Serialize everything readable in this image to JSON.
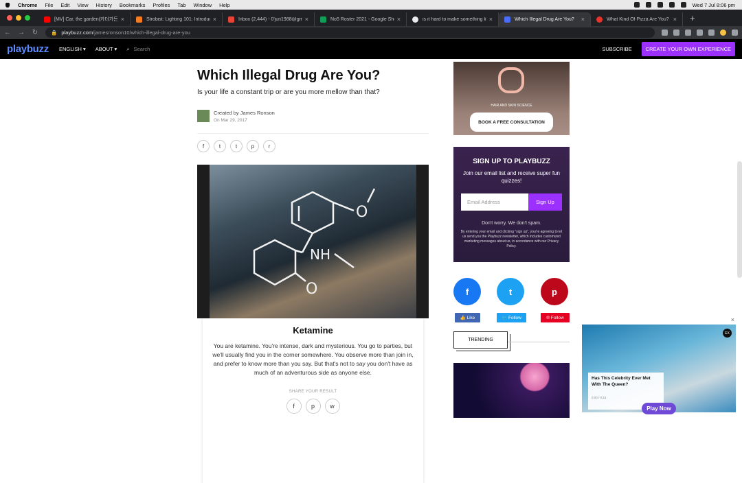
{
  "menubar": {
    "app": "Chrome",
    "items": [
      "File",
      "Edit",
      "View",
      "History",
      "Bookmarks",
      "Profiles",
      "Tab",
      "Window",
      "Help"
    ],
    "clock": "Wed 7 Jul  8:06 pm"
  },
  "tabs": [
    {
      "title": "[MV] Car, the garden(카더가든)",
      "color": "#ff0000"
    },
    {
      "title": "Strobist: Lighting 101: Introduc",
      "color": "#f47b20"
    },
    {
      "title": "Inbox (2,444) - 0'jun1988@gm",
      "color": "#ea4335"
    },
    {
      "title": "No5 Roster 2021 - Google She",
      "color": "#0f9d58"
    },
    {
      "title": "is it hard to make something lik",
      "color": "#e8eaed"
    },
    {
      "title": "Which Illegal Drug Are You?",
      "color": "#4a6cf7"
    },
    {
      "title": "What Kind Of Pizza Are You?",
      "color": "#e8332a"
    }
  ],
  "address": {
    "host": "playbuzz.com",
    "path": "/jamesronson10/which-illegal-drug-are-you"
  },
  "nav": {
    "logo": "playbuzz",
    "lang": "ENGLISH",
    "about": "ABOUT",
    "search_placeholder": "Search",
    "subscribe": "SUBSCRIBE",
    "cta": "CREATE YOUR OWN EXPERIENCE"
  },
  "quiz": {
    "title": "Which Illegal Drug Are You?",
    "subtitle": "Is your life a constant trip or are you more mellow than that?",
    "author": "Created by James Ronson",
    "date": "On Mar 29, 2017"
  },
  "image": {
    "nh": "NH",
    "o1": "O",
    "o2": "O"
  },
  "result": {
    "title": "Ketamine",
    "text": "You are ketamine. You're intense, dark and mysterious. You go to parties, but we'll usually find you in the corner somewhere. You observe more than join in, and prefer to know more than you say. But that's not to say you don't have as much of an adventurous side as anyone else.",
    "share_label": "SHARE YOUR RESULT"
  },
  "ad": {
    "tagline": "HAIR AND SKIN SCIENCE",
    "button": "BOOK A FREE CONSULTATION"
  },
  "signup": {
    "title": "SIGN UP TO PLAYBUZZ",
    "text": "Join our email list and receive super fun quizzes!",
    "placeholder": "Email Address",
    "button": "Sign Up",
    "spam": "Don't worry. We don't spam.",
    "fine": "By entering your email and clicking \"sign up\", you're agreeing to let us send you the Playbuzz newsletter, which includes customized marketing messages about us, in accordance with our Privacy Policy."
  },
  "social": {
    "fb": "Like",
    "tw": "Follow",
    "pin": "Follow"
  },
  "trending": "TRENDING",
  "video": {
    "headline": "Has This Celebrity Ever Met With The Queen?",
    "sub": "0:00 / 0:15",
    "button": "Play Now",
    "badge": "EX"
  }
}
